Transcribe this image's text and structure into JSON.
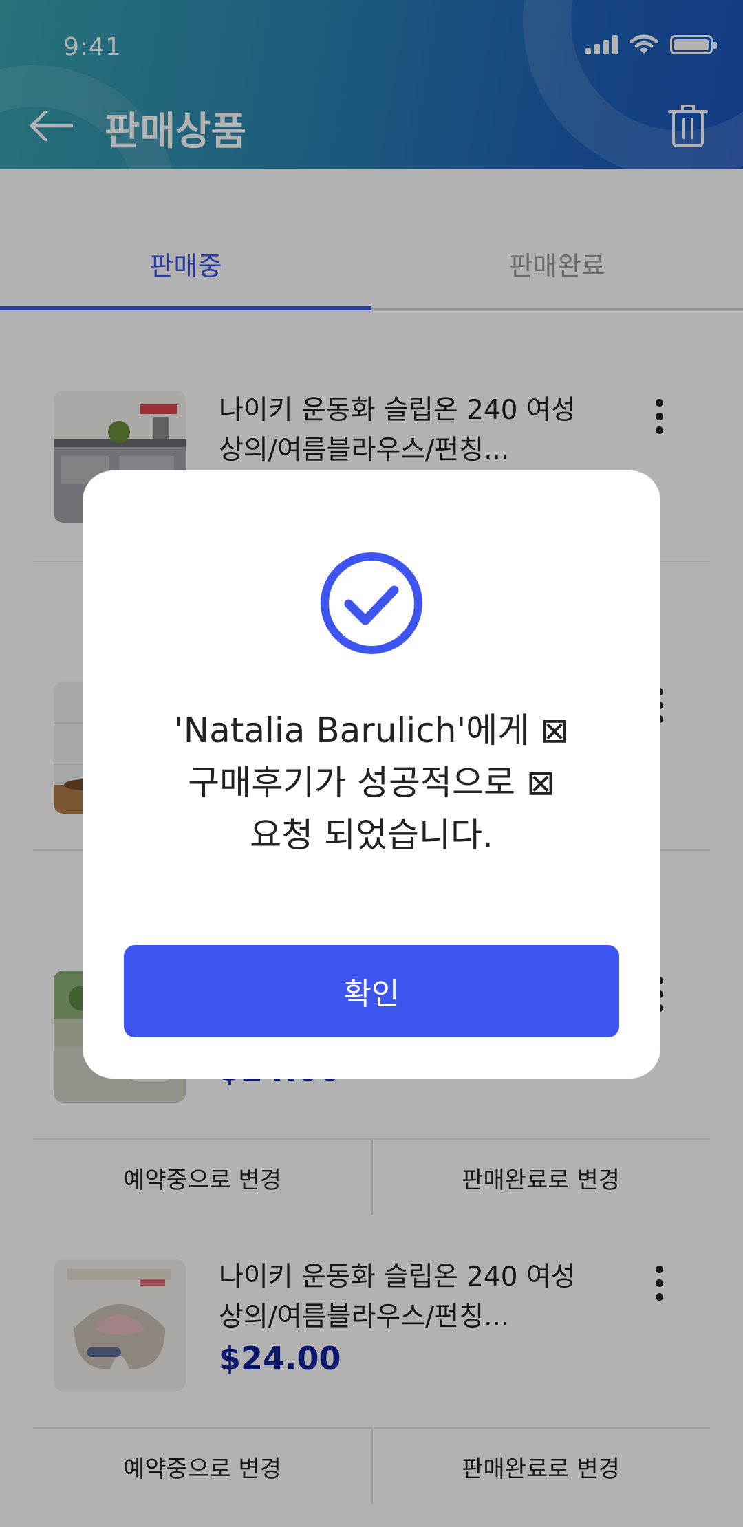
{
  "status_bar": {
    "time": "9:41"
  },
  "header": {
    "title": "판매상품",
    "back_icon": "arrow-left-icon",
    "trash_icon": "trash-icon"
  },
  "tabs": [
    {
      "label": "판매중",
      "active": true
    },
    {
      "label": "판매완료",
      "active": false
    }
  ],
  "items": [
    {
      "title_line1": "나이키 운동화 슬립온 240 여성",
      "title_line2": "상의/여름블라우스/펀칭...",
      "price": "",
      "thumb": "kitchen"
    },
    {
      "title_line1": "",
      "title_line2": "",
      "price": "",
      "thumb": "wall"
    },
    {
      "title_line1": "",
      "title_line2": "",
      "price": "$24.00",
      "thumb": "outdoor",
      "actions": [
        "예약중으로 변경",
        "판매완료로 변경"
      ]
    },
    {
      "title_line1": "나이키 운동화 슬립온 240 여성",
      "title_line2": "상의/여름블라우스/펀칭...",
      "price": "$24.00",
      "thumb": "massager",
      "actions": [
        "예약중으로 변경",
        "판매완료로 변경"
      ]
    }
  ],
  "dialog": {
    "icon": "check-circle-icon",
    "message_line1": "'Natalia Barulich'에게 ⊠",
    "message_line2": "구매후기가 성공적으로 ⊠",
    "message_line3": "요청 되었습니다.",
    "confirm_label": "확인"
  },
  "colors": {
    "accent": "#3d55ee",
    "price": "#14239a",
    "header_start": "#3aa3b1",
    "header_end": "#1d54bf"
  }
}
